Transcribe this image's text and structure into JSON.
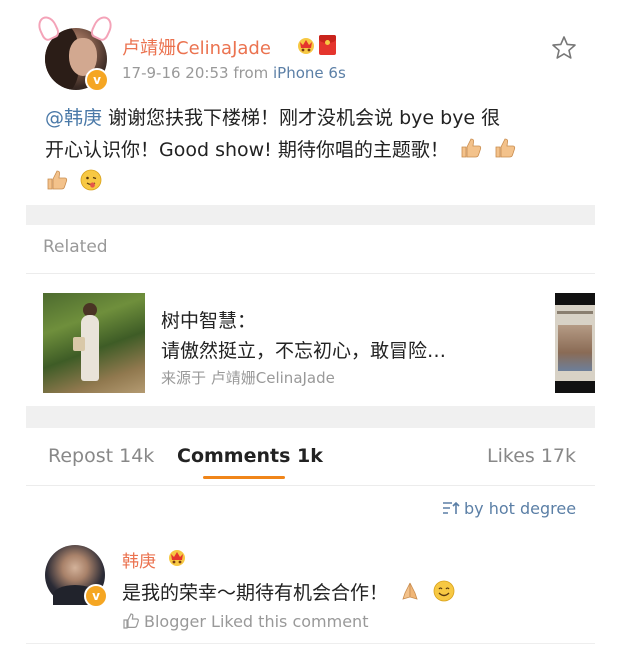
{
  "post": {
    "author_name": "卢靖姗CelinaJade",
    "timestamp": "17-9-16 20:53",
    "source_prefix": "from ",
    "source_device": "iPhone 6s",
    "mention": "@韩庚",
    "text_line1": " 谢谢您扶我下楼梯！刚才没机会说 bye bye 很",
    "text_line2": "开心认识你！Good show! 期待你唱的主题歌！",
    "icons": [
      "vip-crown-icon",
      "red-envelope-icon",
      "star-icon",
      "thumbs-up-emoji",
      "tongue-emoji"
    ]
  },
  "related": {
    "label": "Related",
    "title": "树中智慧：",
    "subtitle": "请傲然挺立，不忘初心，敢冒险…",
    "source": "来源于 卢靖姗CelinaJade"
  },
  "tabs": {
    "repost": "Repost 14k",
    "comments": "Comments 1k",
    "likes": "Likes 17k"
  },
  "sort": {
    "label": "by hot degree"
  },
  "comment": {
    "author": "韩庚",
    "text": "是我的荣幸～期待有机会合作！",
    "liked_note": "Blogger Liked this comment"
  },
  "colors": {
    "name_orange": "#eb7350",
    "link_blue": "#4a79a8",
    "tab_underline": "#f08519",
    "badge_gold": "#f5a623"
  }
}
